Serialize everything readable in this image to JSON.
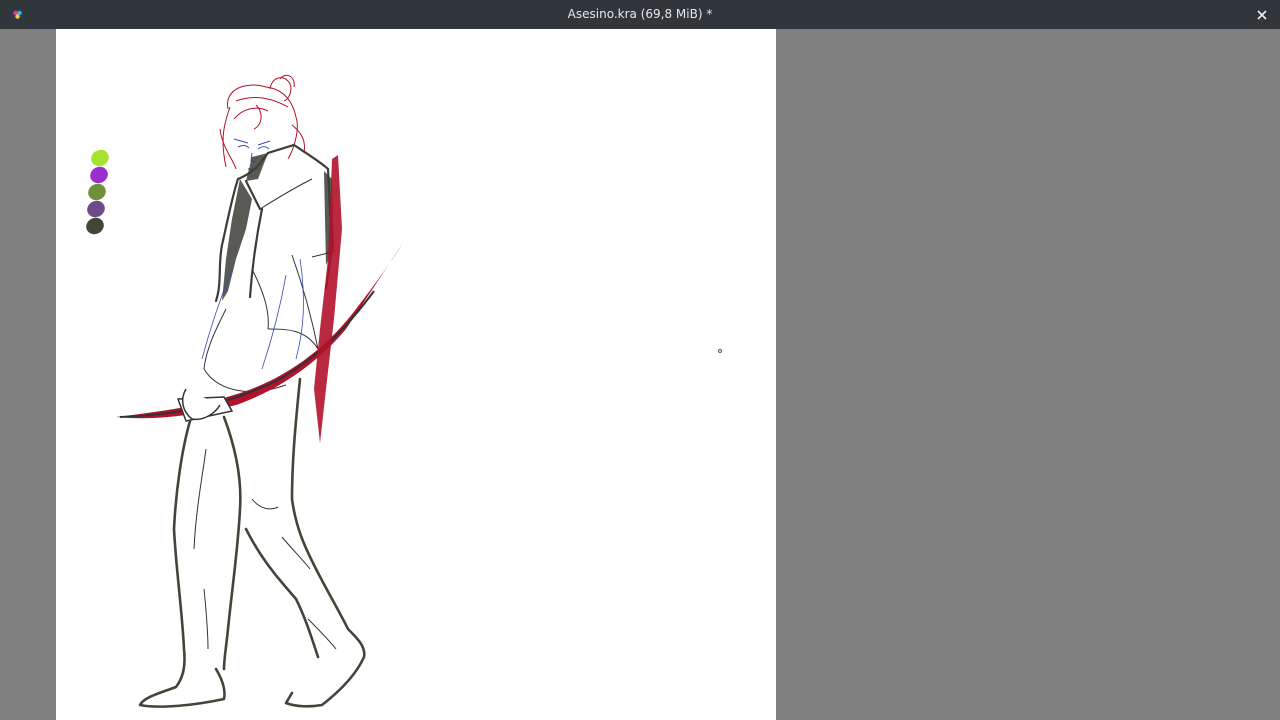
{
  "window": {
    "title": "Asesino.kra (69,8 MiB) *",
    "app_icon": "krita-icon",
    "close_icon": "close-icon"
  },
  "colors": {
    "titlebar": "#31363b",
    "workspace": "#808080",
    "canvas": "#ffffff",
    "sketch_red": "#b3122a",
    "line_dark": "#3a3f36",
    "line_blue": "#3b48b8"
  },
  "palette_swatches": [
    "#a6e22e",
    "#9a2fd0",
    "#6f8f3a",
    "#6d4b8a",
    "#3f4739"
  ]
}
